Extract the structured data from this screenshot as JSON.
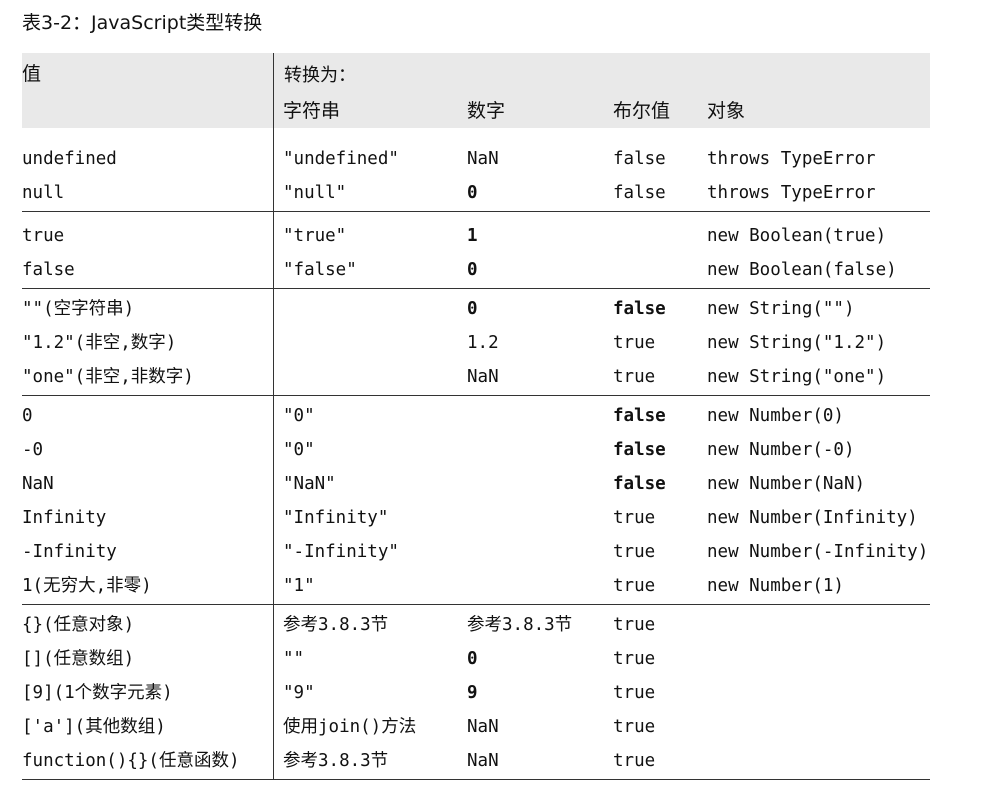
{
  "caption": "表3-2：JavaScript类型转换",
  "header": {
    "value_label": "值",
    "convert_label": "转换为：",
    "col_string": "字符串",
    "col_number": "数字",
    "col_boolean": "布尔值",
    "col_object": "对象"
  },
  "groups": [
    {
      "rows": [
        {
          "value": "undefined",
          "string": "\"undefined\"",
          "number": "NaN",
          "boolean": "false",
          "object": "throws TypeError"
        },
        {
          "value": "null",
          "string": "\"null\"",
          "number": "0",
          "boolean": "false",
          "object": "throws TypeError"
        }
      ]
    },
    {
      "rows": [
        {
          "value": "true",
          "string": "\"true\"",
          "number": "1",
          "boolean": "",
          "object": "new Boolean(true)"
        },
        {
          "value": "false",
          "string": "\"false\"",
          "number": "0",
          "boolean": "",
          "object": "new Boolean(false)"
        }
      ]
    },
    {
      "rows": [
        {
          "value": "\"\"(空字符串)",
          "string": "",
          "number": "0",
          "boolean": "false",
          "object": "new String(\"\")"
        },
        {
          "value": "\"1.2\"(非空,数字)",
          "string": "",
          "number": "1.2",
          "boolean": "true",
          "object": "new String(\"1.2\")"
        },
        {
          "value": "\"one\"(非空,非数字)",
          "string": "",
          "number": "NaN",
          "boolean": "true",
          "object": "new String(\"one\")"
        }
      ]
    },
    {
      "rows": [
        {
          "value": "0",
          "string": "\"0\"",
          "number": "",
          "boolean": "false",
          "object": "new Number(0)"
        },
        {
          "value": "-0",
          "string": "\"0\"",
          "number": "",
          "boolean": "false",
          "object": "new Number(-0)"
        },
        {
          "value": "NaN",
          "string": "\"NaN\"",
          "number": "",
          "boolean": "false",
          "object": "new Number(NaN)"
        },
        {
          "value": "Infinity",
          "string": "\"Infinity\"",
          "number": "",
          "boolean": "true",
          "object": "new Number(Infinity)"
        },
        {
          "value": "-Infinity",
          "string": "\"-Infinity\"",
          "number": "",
          "boolean": "true",
          "object": "new Number(-Infinity)"
        },
        {
          "value": "1(无穷大,非零)",
          "string": "\"1\"",
          "number": "",
          "boolean": "true",
          "object": "new Number(1)"
        }
      ]
    },
    {
      "rows": [
        {
          "value": "{}(任意对象)",
          "string": "参考3.8.3节",
          "number": "参考3.8.3节",
          "boolean": "true",
          "object": ""
        },
        {
          "value": "[](任意数组)",
          "string": "\"\"",
          "number": "0",
          "boolean": "true",
          "object": ""
        },
        {
          "value": "[9](1个数字元素)",
          "string": "\"9\"",
          "number": "9",
          "boolean": "true",
          "object": ""
        },
        {
          "value": "['a'](其他数组)",
          "string": "使用join()方法",
          "number": "NaN",
          "boolean": "true",
          "object": ""
        },
        {
          "value": "function(){}(任意函数)",
          "string": "参考3.8.3节",
          "number": "NaN",
          "boolean": "true",
          "object": ""
        }
      ]
    }
  ]
}
